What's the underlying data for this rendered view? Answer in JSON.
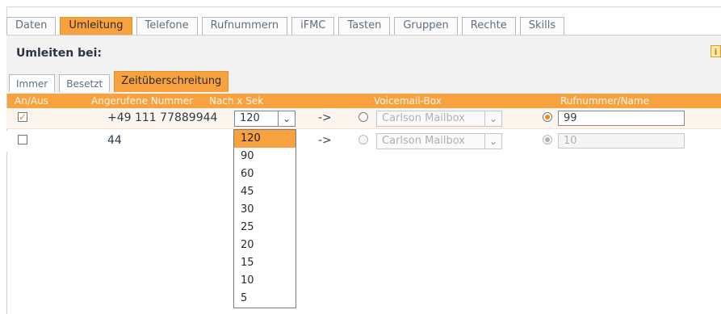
{
  "main_tabs": [
    {
      "label": "Daten"
    },
    {
      "label": "Umleitung"
    },
    {
      "label": "Telefone"
    },
    {
      "label": "Rufnummern"
    },
    {
      "label": "iFMC"
    },
    {
      "label": "Tasten"
    },
    {
      "label": "Gruppen"
    },
    {
      "label": "Rechte"
    },
    {
      "label": "Skills"
    }
  ],
  "section": {
    "title": "Umleiten bei:",
    "info_icon": "i"
  },
  "sub_tabs": [
    {
      "label": "Immer"
    },
    {
      "label": "Besetzt"
    },
    {
      "label": "Zeitüberschreitung"
    }
  ],
  "table_headers": {
    "an_aus": "An/Aus",
    "angerufene_nummer": "Angerufene Nummer",
    "nach_x_sek": "Nach x Sek",
    "voicemail_box": "Voicemail-Box",
    "rufnummer_name": "Rufnummer/Name"
  },
  "rows": [
    {
      "enabled": true,
      "number": "+49 111 77889944",
      "delay": "120",
      "arrow": "->",
      "voicemail": "Carlson Mailbox",
      "target": "99"
    },
    {
      "enabled": false,
      "number": "44",
      "arrow": "->",
      "voicemail": "Carlson Mailbox",
      "target": "10"
    }
  ],
  "dropdown": {
    "options": [
      "120",
      "90",
      "60",
      "45",
      "30",
      "25",
      "20",
      "15",
      "10",
      "5"
    ],
    "selected": "120"
  },
  "colors": {
    "accent": "#f7a13f",
    "row_highlight": "#fcf5ee"
  },
  "icons": {
    "checkbox_checked": "checkbox-checked-icon",
    "checkbox_unchecked": "checkbox-unchecked-icon",
    "select_arrow": "chevron-down-icon",
    "radio_selected": "radio-selected-icon",
    "radio_unselected": "radio-unselected-icon",
    "info": "info-icon"
  }
}
